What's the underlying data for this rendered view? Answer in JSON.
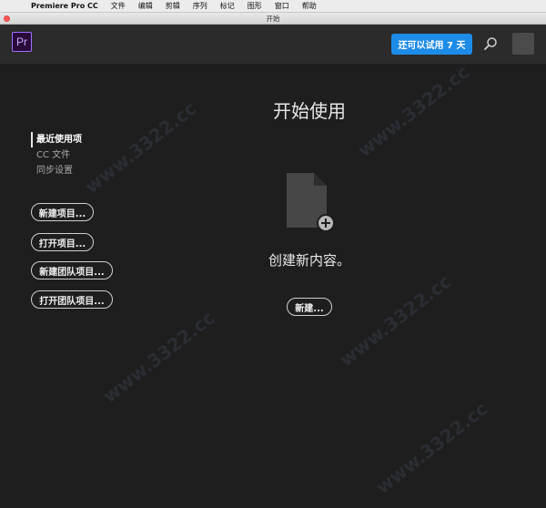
{
  "menubar": {
    "app_name": "Premiere Pro CC",
    "items": [
      "文件",
      "编辑",
      "剪辑",
      "序列",
      "标记",
      "图形",
      "窗口",
      "帮助"
    ]
  },
  "window": {
    "title": "开始"
  },
  "header": {
    "logo_text": "Pr",
    "trial_label": "还可以试用 7 天"
  },
  "sidebar": {
    "links": [
      "最近使用项",
      "CC 文件",
      "同步设置"
    ],
    "buttons": [
      "新建项目...",
      "打开项目...",
      "新建团队项目...",
      "打开团队项目..."
    ]
  },
  "main": {
    "title": "开始使用",
    "subtitle": "创建新内容。",
    "new_button": "新建..."
  },
  "watermark_text": "www.3322.cc",
  "colors": {
    "trial_blue": "#1d8ce8",
    "pr_purple": "#9a73ff",
    "background": "#1e1e1e"
  }
}
